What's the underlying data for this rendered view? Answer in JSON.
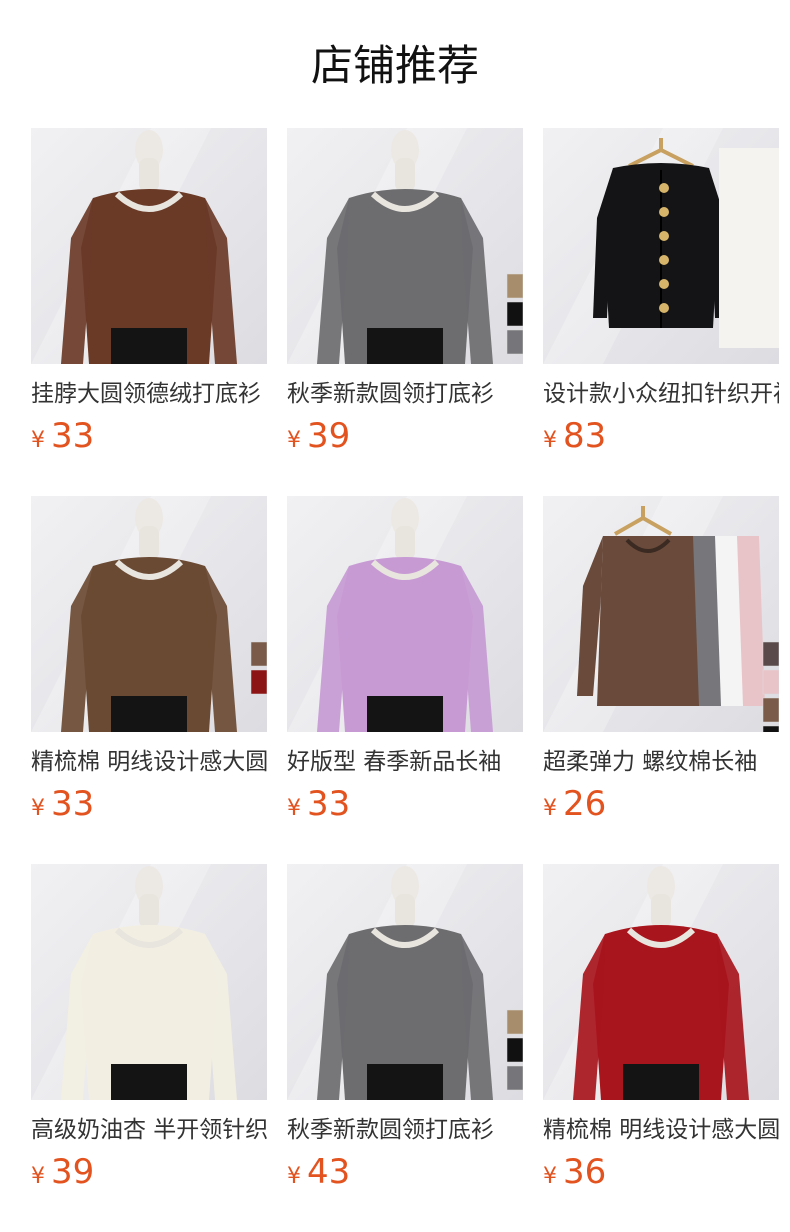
{
  "header": {
    "title": "店铺推荐"
  },
  "currency_symbol": "¥",
  "products": [
    {
      "name": "挂脖大圆领德绒打底衫",
      "price": "33",
      "color": "#6a3a27",
      "style": "mannequin",
      "swatches": []
    },
    {
      "name": "秋季新款圆领打底衫",
      "price": "39",
      "color": "#6d6d70",
      "style": "mannequin",
      "swatches": [
        "#a88d6d",
        "#111111",
        "#76767a"
      ]
    },
    {
      "name": "设计款小众纽扣针织开衫",
      "price": "83",
      "color": "#141416",
      "style": "hanger",
      "swatches": []
    },
    {
      "name": "精梳棉 明线设计感大圆领",
      "price": "33",
      "color": "#6b4a33",
      "style": "mannequin",
      "swatches": [
        "#7a5a48",
        "#8d1414"
      ]
    },
    {
      "name": "好版型 春季新品长袖",
      "price": "33",
      "color": "#c79ad4",
      "style": "mannequin",
      "swatches": []
    },
    {
      "name": "超柔弹力 螺纹棉长袖",
      "price": "26",
      "color": "#6a4a3a",
      "style": "hanger-multi",
      "swatches": [
        "#5a4a4a",
        "#e8c4c8",
        "#7a5a48",
        "#111111",
        "#ffffff"
      ]
    },
    {
      "name": "高级奶油杏 半开领针织",
      "price": "39",
      "color": "#f2efe2",
      "style": "mannequin",
      "swatches": []
    },
    {
      "name": "秋季新款圆领打底衫",
      "price": "43",
      "color": "#6d6d70",
      "style": "mannequin",
      "swatches": [
        "#a88d6d",
        "#111111",
        "#76767a"
      ]
    },
    {
      "name": "精梳棉 明线设计感大圆领",
      "price": "36",
      "color": "#a8151c",
      "style": "mannequin",
      "swatches": []
    }
  ]
}
